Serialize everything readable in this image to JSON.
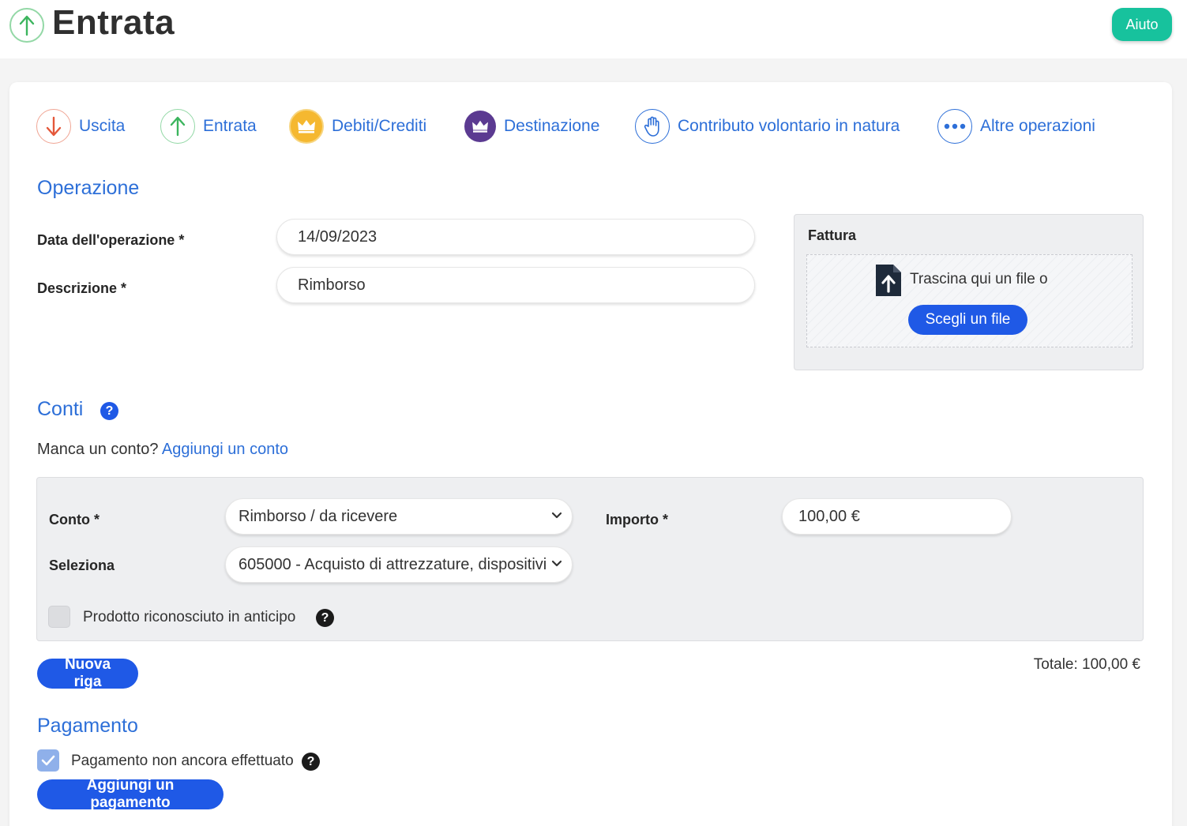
{
  "header": {
    "title": "Entrata",
    "help_label": "Aiuto"
  },
  "tabs": [
    {
      "label": "Uscita",
      "icon": "arrow-down-icon",
      "color": "#e4573a"
    },
    {
      "label": "Entrata",
      "icon": "arrow-up-icon",
      "color": "#3cb55e"
    },
    {
      "label": "Debiti/Crediti",
      "icon": "crown-coin-icon",
      "color": "#f0b42a"
    },
    {
      "label": "Destinazione",
      "icon": "crown-swap-icon",
      "color": "#5b3a91"
    },
    {
      "label": "Contributo volontario in natura",
      "icon": "hand-icon",
      "color": "#2d6fd8"
    },
    {
      "label": "Altre operazioni",
      "icon": "more-dots-icon",
      "color": "#2d6fd8"
    }
  ],
  "operation": {
    "section_title": "Operazione",
    "date_label": "Data dell'operazione *",
    "date_value": "14/09/2023",
    "description_label": "Descrizione *",
    "description_value": "Rimborso"
  },
  "invoice": {
    "title": "Fattura",
    "drop_text": "Trascina qui un file o",
    "choose_button": "Scegli un file"
  },
  "accounts": {
    "section_title": "Conti",
    "missing_text": "Manca un conto?",
    "add_link": "Aggiungi un conto",
    "account_label": "Conto *",
    "account_value": "Rimborso / da ricevere",
    "amount_label": "Importo *",
    "amount_value": "100,00 €",
    "select_label": "Seleziona",
    "select_value": "605000 - Acquisto di attrezzature, dispositivi",
    "advance_label": "Prodotto riconosciuto in anticipo",
    "new_row_button": "Nuova riga",
    "total_text": "Totale: 100,00 €"
  },
  "payment": {
    "section_title": "Pagamento",
    "not_done_label": "Pagamento non ancora effettuato",
    "not_done_checked": true,
    "add_button": "Aggiungi un pagamento"
  },
  "colors": {
    "accent": "#2d6fd8",
    "button": "#1f59e6",
    "help_button": "#17c29d"
  }
}
